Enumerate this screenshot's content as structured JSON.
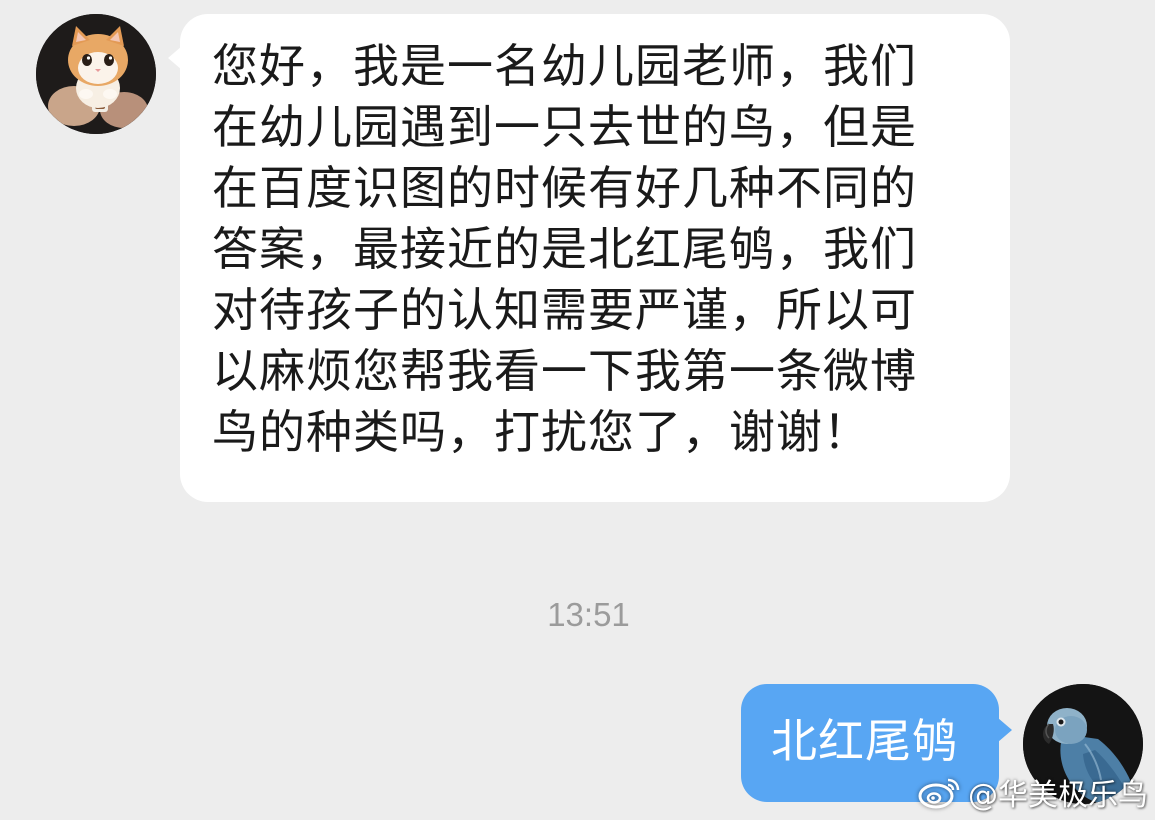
{
  "chat": {
    "messages": [
      {
        "direction": "incoming",
        "sender_avatar": "cat-avatar",
        "text": "您好，我是一名幼儿园老师，我们\n在幼儿园遇到一只去世的鸟，但是\n在百度识图的时候有好几种不同的\n答案，最接近的是北红尾鸲，我们\n对待孩子的认知需要严谨，所以可\n以麻烦您帮我看一下我第一条微博\n鸟的种类吗，打扰您了，谢谢！"
      },
      {
        "direction": "outgoing",
        "sender_avatar": "parrot-avatar",
        "text": "北红尾鸲"
      }
    ],
    "timestamp": "13:51"
  },
  "watermark": {
    "icon": "weibo-icon",
    "handle": "@华美极乐鸟"
  },
  "colors": {
    "background": "#ededed",
    "incoming_bubble": "#ffffff",
    "outgoing_bubble": "#58a6f3",
    "timestamp_text": "#9b9b9b"
  }
}
